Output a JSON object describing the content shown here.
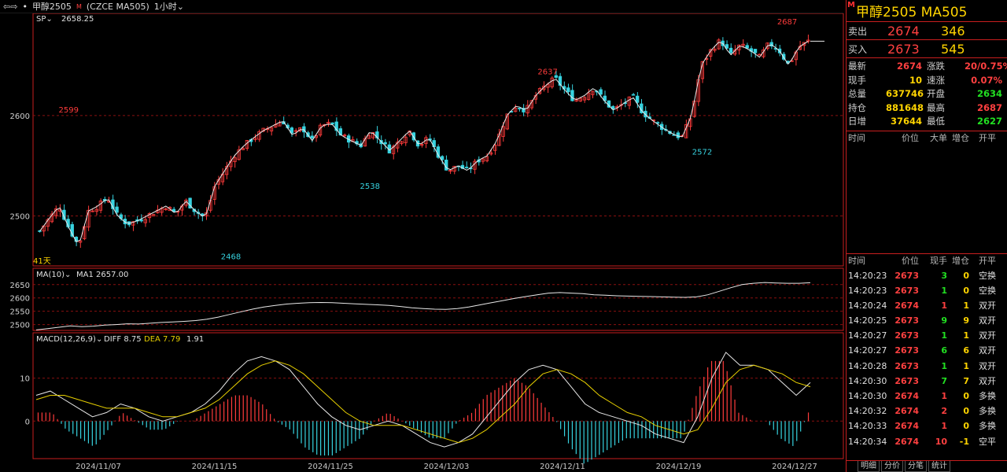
{
  "window": {
    "symbol_name": "甲醇2505",
    "badge": "M",
    "exchange_code": "(CZCE MA505)",
    "period": "1小时"
  },
  "main_chart": {
    "label": "SP",
    "value": "2658.25",
    "days_label": "41天",
    "y_ticks": [
      "2600",
      "2500"
    ],
    "annotations": [
      "2599",
      "2468",
      "2538",
      "2637",
      "2572",
      "2687"
    ]
  },
  "ma_panel": {
    "label": "MA(10)",
    "ma1_text": "MA1 2657.00",
    "y_ticks": [
      "2650",
      "2600",
      "2550",
      "2500"
    ]
  },
  "macd_panel": {
    "label": "MACD(12,26,9)",
    "diff_text": "DIFF 8.75",
    "dea_text": "DEA 7.79",
    "macd_text": "1.91",
    "y_ticks": [
      "10",
      "0"
    ]
  },
  "x_axis": {
    "labels": [
      "2024/11/07",
      "2024/11/15",
      "2024/11/25",
      "2024/12/03",
      "2024/12/11",
      "2024/12/19",
      "2024/12/27"
    ]
  },
  "chart_data": {
    "type": "candlestick",
    "title": "甲醇2505",
    "price_ylim": [
      2455,
      2697
    ],
    "price_marks": [
      {
        "label": "2468",
        "value": 2468
      },
      {
        "label": "2599",
        "value": 2599
      },
      {
        "label": "2538",
        "value": 2538
      },
      {
        "label": "2637",
        "value": 2637
      },
      {
        "label": "2572",
        "value": 2572
      },
      {
        "label": "2687",
        "value": 2687
      }
    ],
    "close_path": [
      2485,
      2498,
      2510,
      2488,
      2470,
      2505,
      2510,
      2518,
      2500,
      2492,
      2495,
      2500,
      2505,
      2510,
      2502,
      2515,
      2505,
      2498,
      2530,
      2545,
      2560,
      2570,
      2578,
      2585,
      2590,
      2595,
      2580,
      2588,
      2575,
      2590,
      2592,
      2580,
      2575,
      2570,
      2585,
      2575,
      2565,
      2575,
      2585,
      2570,
      2578,
      2560,
      2545,
      2550,
      2545,
      2555,
      2560,
      2575,
      2600,
      2610,
      2605,
      2620,
      2630,
      2637,
      2625,
      2615,
      2620,
      2628,
      2615,
      2605,
      2612,
      2618,
      2603,
      2595,
      2588,
      2582,
      2578,
      2600,
      2650,
      2665,
      2675,
      2660,
      2670,
      2665,
      2658,
      2672,
      2665,
      2650,
      2668,
      2674
    ],
    "ma10": [
      2480,
      2485,
      2490,
      2495,
      2492,
      2494,
      2498,
      2500,
      2503,
      2502,
      2505,
      2508,
      2510,
      2512,
      2515,
      2520,
      2528,
      2538,
      2548,
      2558,
      2566,
      2572,
      2577,
      2580,
      2582,
      2583,
      2582,
      2580,
      2578,
      2576,
      2574,
      2572,
      2568,
      2563,
      2560,
      2558,
      2557,
      2560,
      2566,
      2574,
      2582,
      2590,
      2598,
      2605,
      2612,
      2618,
      2620,
      2618,
      2616,
      2612,
      2610,
      2608,
      2607,
      2606,
      2605,
      2604,
      2603,
      2602,
      2604,
      2612,
      2625,
      2638,
      2650,
      2655,
      2658,
      2656,
      2655,
      2655,
      2657
    ],
    "ma10_ylim": [
      2490,
      2670
    ],
    "macd_diff": [
      6,
      7,
      5,
      3,
      1,
      2,
      4,
      3,
      1,
      0,
      1,
      2,
      4,
      7,
      11,
      14,
      15,
      14,
      12,
      8,
      4,
      1,
      -1,
      -2,
      -1,
      0,
      -1,
      -3,
      -5,
      -6,
      -5,
      -3,
      1,
      5,
      9,
      12,
      13,
      12,
      8,
      4,
      2,
      1,
      0,
      -1,
      -3,
      -4,
      -5,
      1,
      10,
      16,
      13,
      13,
      12,
      9,
      6,
      9
    ],
    "macd_dea": [
      5,
      6,
      6,
      5,
      4,
      3,
      3,
      3,
      2,
      1,
      1,
      2,
      3,
      5,
      8,
      11,
      13,
      14,
      13,
      11,
      8,
      5,
      2,
      0,
      -1,
      -1,
      -1,
      -2,
      -3,
      -4,
      -5,
      -4,
      -2,
      1,
      4,
      8,
      11,
      12,
      11,
      9,
      6,
      4,
      2,
      1,
      -1,
      -2,
      -3,
      -2,
      3,
      9,
      12,
      13,
      12,
      11,
      9,
      8
    ],
    "macd_ylim": [
      -8,
      18
    ]
  },
  "right_panel": {
    "title": "甲醇2505  MA505",
    "badge": "M",
    "ask": {
      "label": "卖出",
      "price": "2674",
      "volume": "346"
    },
    "bid": {
      "label": "买入",
      "price": "2673",
      "volume": "545"
    },
    "stats": [
      {
        "k": "最新",
        "v": "2674",
        "c": "red",
        "k2": "涨跌",
        "v2": "20/0.75%",
        "c2": "red"
      },
      {
        "k": "现手",
        "v": "10",
        "c": "yellow",
        "k2": "速涨",
        "v2": "0.07%",
        "c2": "red"
      },
      {
        "k": "总量",
        "v": "637746",
        "c": "yellow",
        "k2": "开盘",
        "v2": "2634",
        "c2": "green"
      },
      {
        "k": "持仓",
        "v": "881648",
        "c": "yellow",
        "k2": "最高",
        "v2": "2687",
        "c2": "red"
      },
      {
        "k": "日增",
        "v": "37644",
        "c": "yellow",
        "k2": "最低",
        "v2": "2627",
        "c2": "green"
      }
    ],
    "tick_header": [
      "时间",
      "价位",
      "大单",
      "增仓",
      "开平"
    ],
    "tick_header2": [
      "时间",
      "价位",
      "现手",
      "增仓",
      "开平"
    ],
    "ticks": [
      {
        "time": "14:20:23",
        "price": "2673",
        "pc": "red",
        "vol": "3",
        "vc": "green",
        "oi": "0",
        "kind": "空换"
      },
      {
        "time": "14:20:23",
        "price": "2673",
        "pc": "red",
        "vol": "1",
        "vc": "green",
        "oi": "0",
        "kind": "空换"
      },
      {
        "time": "14:20:24",
        "price": "2674",
        "pc": "red",
        "vol": "1",
        "vc": "red",
        "oi": "1",
        "kind": "双开"
      },
      {
        "time": "14:20:25",
        "price": "2673",
        "pc": "red",
        "vol": "9",
        "vc": "green",
        "oi": "9",
        "kind": "双开"
      },
      {
        "time": "14:20:27",
        "price": "2673",
        "pc": "red",
        "vol": "1",
        "vc": "green",
        "oi": "1",
        "kind": "双开"
      },
      {
        "time": "14:20:27",
        "price": "2673",
        "pc": "red",
        "vol": "6",
        "vc": "green",
        "oi": "6",
        "kind": "双开"
      },
      {
        "time": "14:20:28",
        "price": "2673",
        "pc": "red",
        "vol": "1",
        "vc": "green",
        "oi": "1",
        "kind": "双开"
      },
      {
        "time": "14:20:30",
        "price": "2673",
        "pc": "red",
        "vol": "7",
        "vc": "green",
        "oi": "7",
        "kind": "双开"
      },
      {
        "time": "14:20:30",
        "price": "2674",
        "pc": "red",
        "vol": "1",
        "vc": "red",
        "oi": "0",
        "kind": "多换"
      },
      {
        "time": "14:20:32",
        "price": "2674",
        "pc": "red",
        "vol": "2",
        "vc": "red",
        "oi": "0",
        "kind": "多换"
      },
      {
        "time": "14:20:33",
        "price": "2674",
        "pc": "red",
        "vol": "1",
        "vc": "red",
        "oi": "0",
        "kind": "多换"
      },
      {
        "time": "14:20:34",
        "price": "2674",
        "pc": "red",
        "vol": "10",
        "vc": "red",
        "oi": "-1",
        "kind": "空平"
      }
    ],
    "tabs": [
      "明细",
      "分价",
      "分笔",
      "统计"
    ]
  },
  "colors": {
    "up": "#ff3b3b",
    "down": "#37d3e0",
    "ma": "#e8e8e8",
    "dea": "#e8d000",
    "grid": "#8a1010",
    "panel_border": "#c81e1e"
  }
}
